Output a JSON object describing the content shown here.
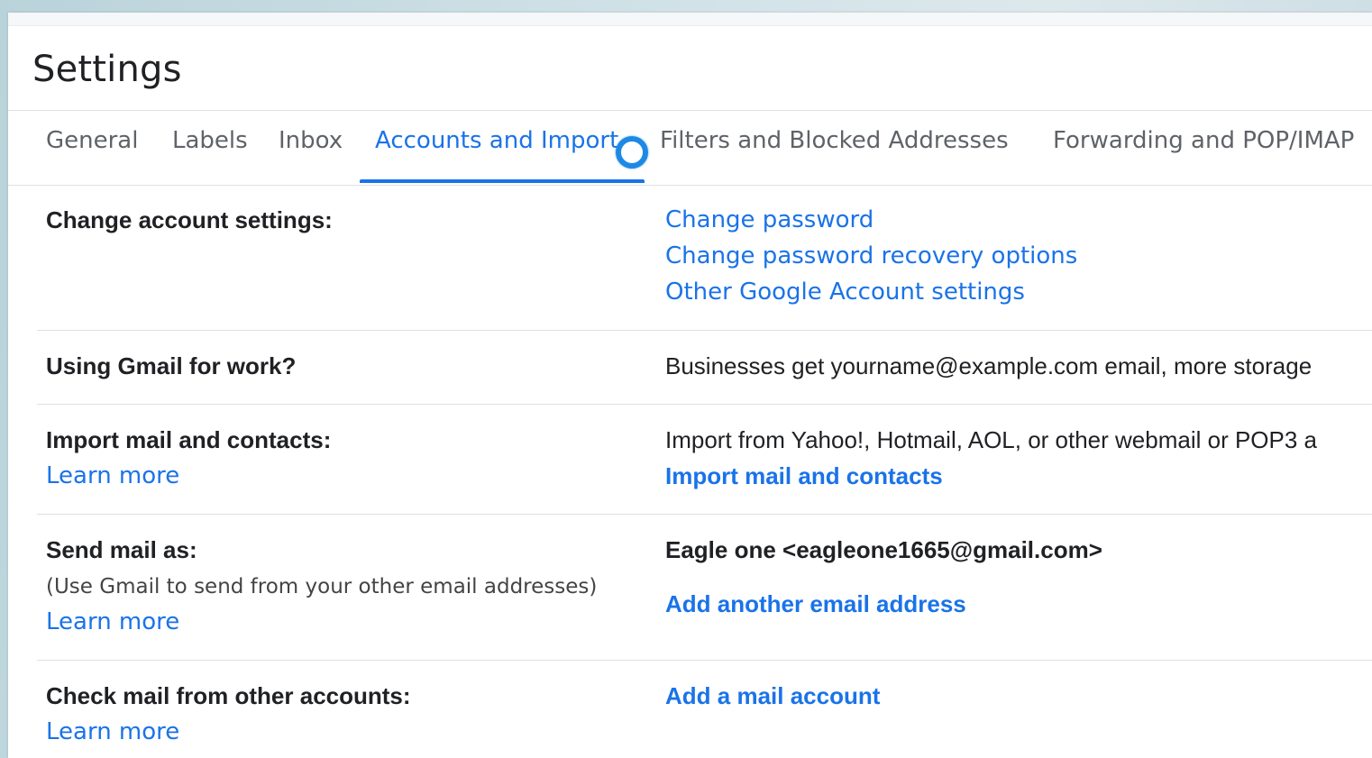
{
  "page": {
    "title": "Settings"
  },
  "tabs": [
    {
      "label": "General"
    },
    {
      "label": "Labels"
    },
    {
      "label": "Inbox"
    },
    {
      "label": "Accounts and Import",
      "active": true
    },
    {
      "label": "Filters and Blocked Addresses"
    },
    {
      "label": "Forwarding and POP/IMAP"
    }
  ],
  "sections": {
    "change_account": {
      "label": "Change account settings:",
      "links": [
        "Change password",
        "Change password recovery options",
        "Other Google Account settings"
      ]
    },
    "gmail_work": {
      "label": "Using Gmail for work?",
      "text": "Businesses get yourname@example.com email, more storage"
    },
    "import": {
      "label": "Import mail and contacts:",
      "learn_more": "Learn more",
      "text": "Import from Yahoo!, Hotmail, AOL, or other webmail or POP3 a",
      "action": "Import mail and contacts"
    },
    "send_as": {
      "label": "Send mail as:",
      "sub": "(Use Gmail to send from your other email addresses)",
      "learn_more": "Learn more",
      "address": "Eagle one <eagleone1665@gmail.com>",
      "action": "Add another email address"
    },
    "check_mail": {
      "label": "Check mail from other accounts:",
      "learn_more": "Learn more",
      "action": "Add a mail account"
    }
  },
  "colors": {
    "accent": "#1a73e8",
    "text": "#202124",
    "muted": "#5f6368"
  }
}
